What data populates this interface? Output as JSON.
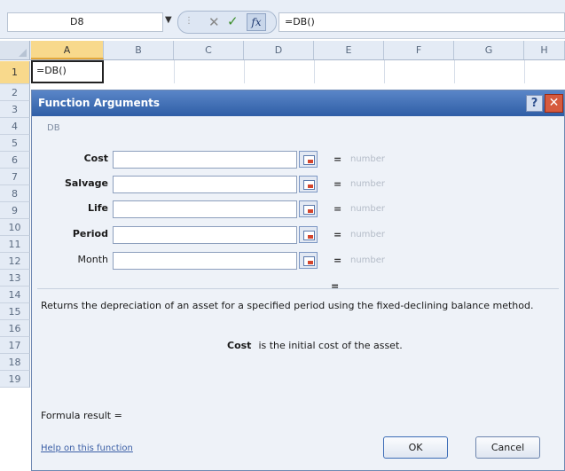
{
  "formula_bar": {
    "name_box": "D8",
    "dropdown_icon": "chevron-down-icon",
    "cancel_glyph": "✕",
    "enter_glyph": "✓",
    "fx_label": "fx",
    "formula": "=DB()"
  },
  "columns": [
    "A",
    "B",
    "C",
    "D",
    "E",
    "F",
    "G",
    "H"
  ],
  "rows": [
    "1",
    "2",
    "3",
    "4",
    "5",
    "6",
    "7",
    "8",
    "9",
    "10",
    "11",
    "12",
    "13",
    "14",
    "15",
    "16",
    "17",
    "18",
    "19"
  ],
  "cells": {
    "A1": "=DB()"
  },
  "dialog": {
    "title": "Function Arguments",
    "help_glyph": "?",
    "close_glyph": "✕",
    "function_name": "DB",
    "arguments": [
      {
        "label": "Cost",
        "bold": true,
        "value": "",
        "equals": "=",
        "result": "number"
      },
      {
        "label": "Salvage",
        "bold": true,
        "value": "",
        "equals": "=",
        "result": "number"
      },
      {
        "label": "Life",
        "bold": true,
        "value": "",
        "equals": "=",
        "result": "number"
      },
      {
        "label": "Period",
        "bold": true,
        "value": "",
        "equals": "=",
        "result": "number"
      },
      {
        "label": "Month",
        "bold": false,
        "value": "",
        "equals": "=",
        "result": "number"
      }
    ],
    "total_equals": "=",
    "description": "Returns the depreciation of an asset for a specified period using the fixed-declining balance method.",
    "arg_description_name": "Cost",
    "arg_description_text": "is the initial cost of the asset.",
    "formula_result_label": "Formula result =",
    "help_link": "Help on this function",
    "ok_label": "OK",
    "cancel_label": "Cancel"
  },
  "colors": {
    "title_bar": "#3d6db5",
    "selected_header": "#f8d98c",
    "close_button": "#d65a3e"
  }
}
